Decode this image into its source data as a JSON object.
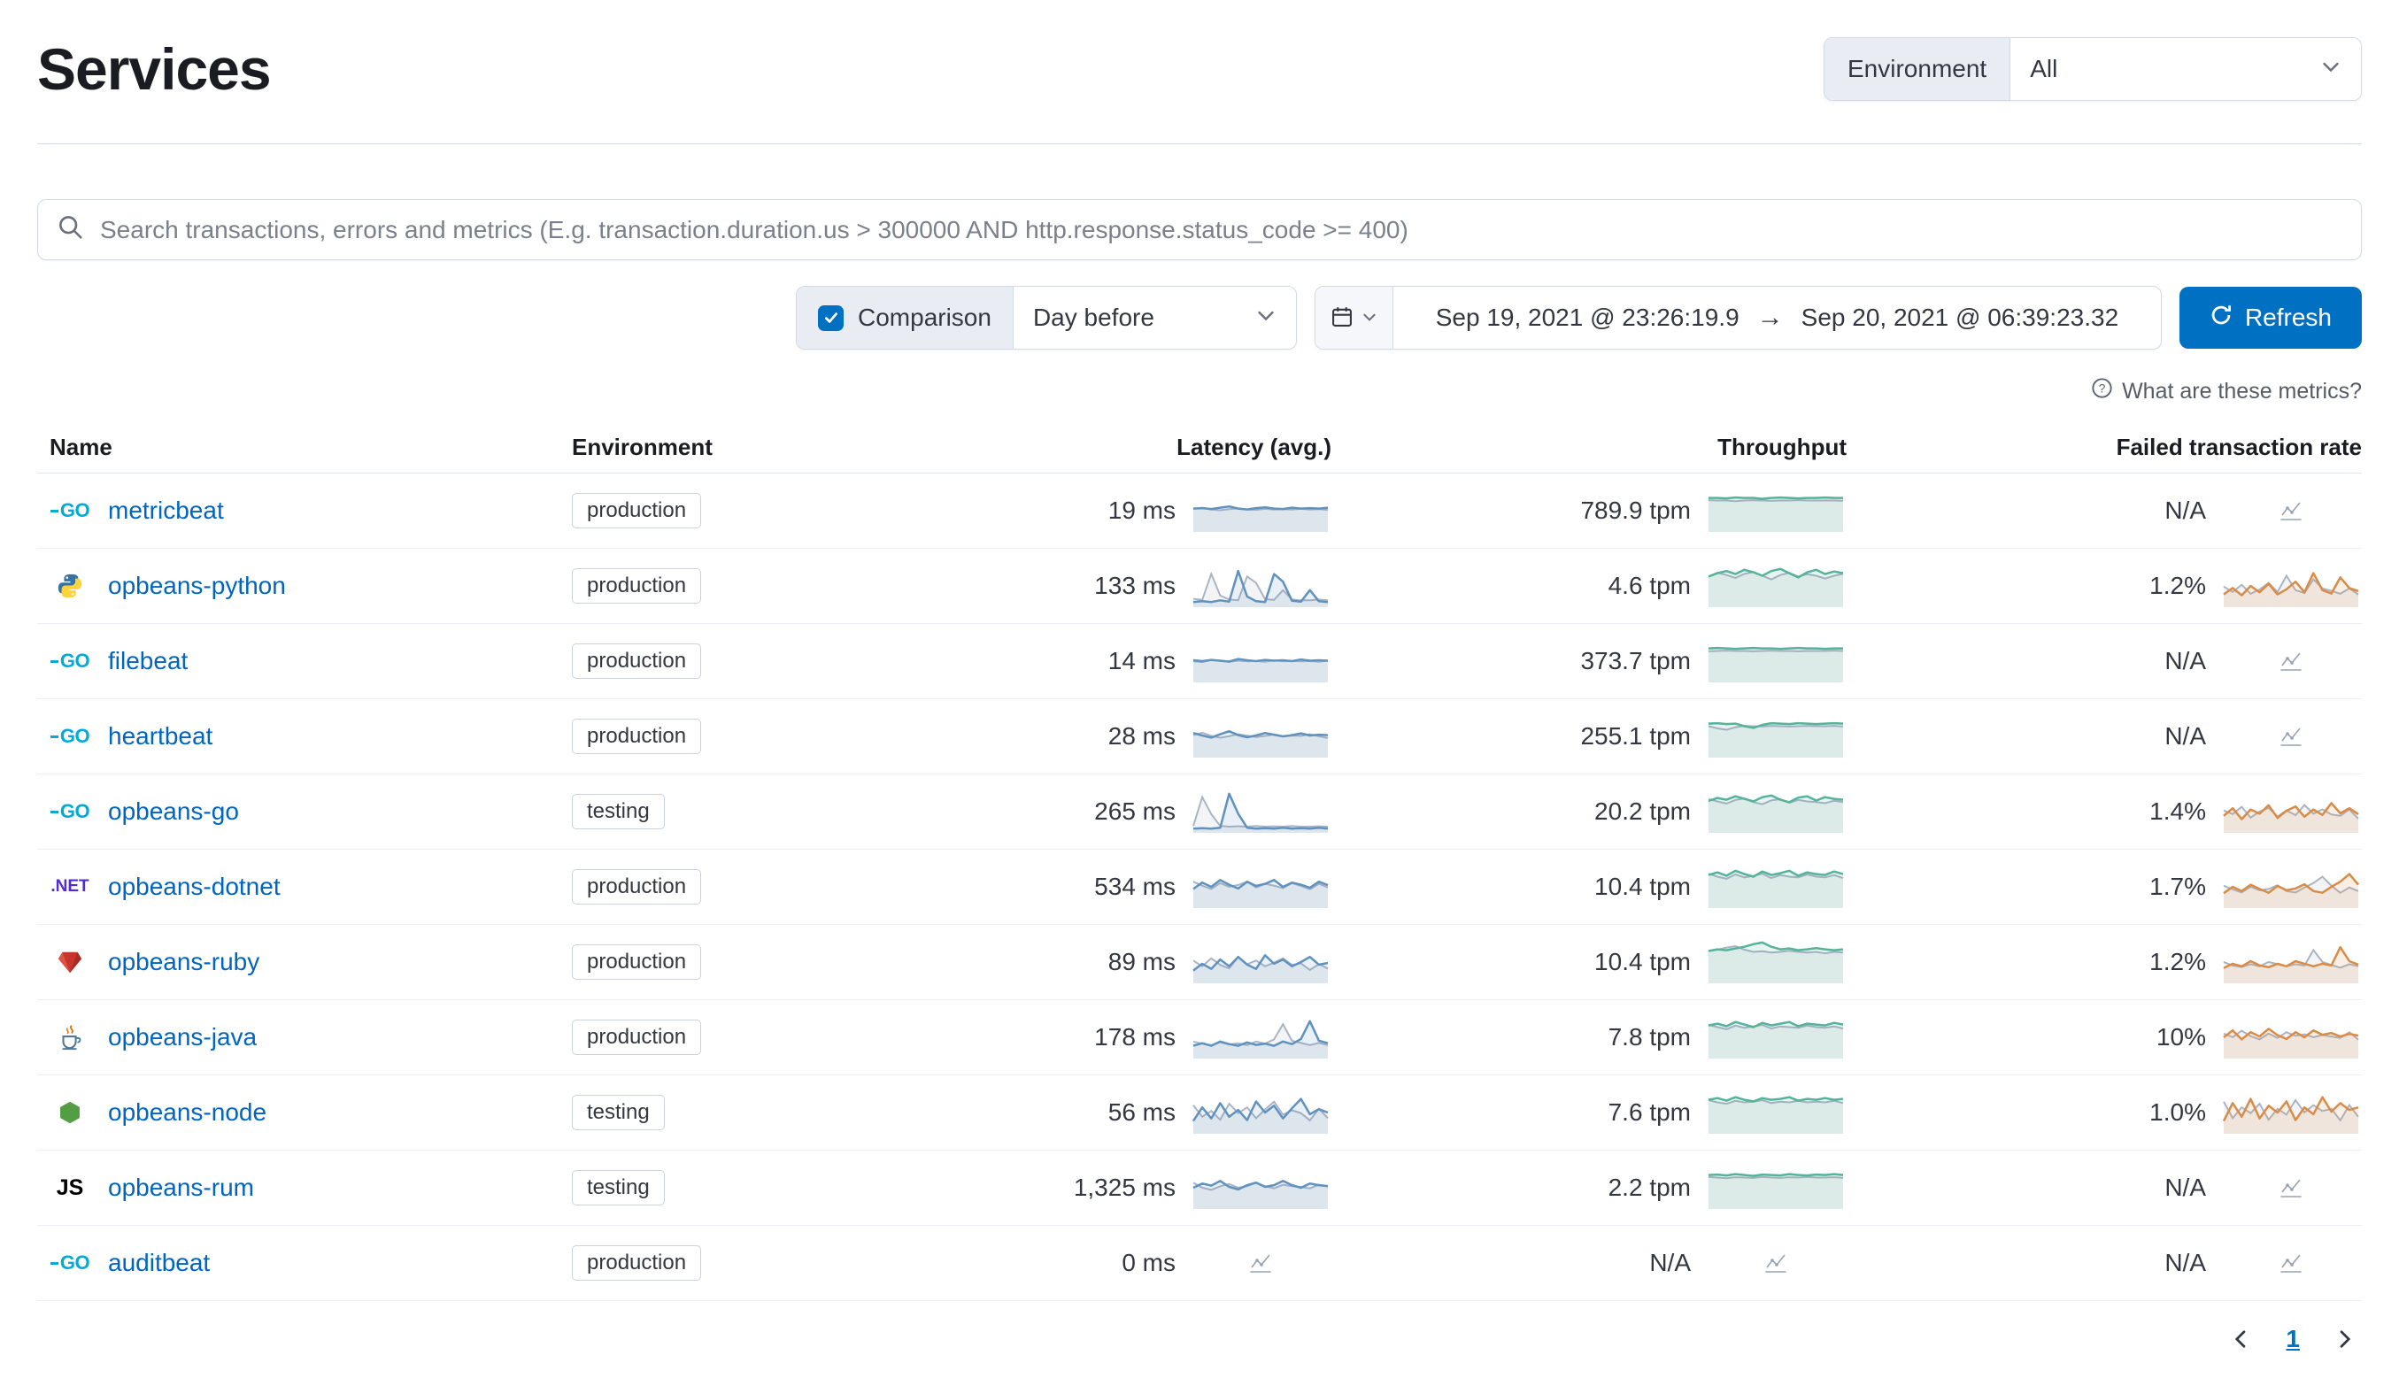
{
  "header": {
    "title": "Services",
    "environment_filter": {
      "label": "Environment",
      "value": "All"
    }
  },
  "search": {
    "placeholder": "Search transactions, errors and metrics (E.g. transaction.duration.us > 300000 AND http.response.status_code >= 400)"
  },
  "controls": {
    "comparison_label": "Comparison",
    "comparison_checked": true,
    "comparison_select": "Day before",
    "date_start": "Sep 19, 2021 @ 23:26:19.9",
    "date_end": "Sep 20, 2021 @ 06:39:23.32",
    "refresh_label": "Refresh"
  },
  "metrics_help": "What are these metrics?",
  "colors": {
    "latency": "#6092C0",
    "throughput": "#54B399",
    "failed": "#DA8B45",
    "comparison": "#ABB4C4"
  },
  "table": {
    "columns": [
      "Name",
      "Environment",
      "Latency (avg.)",
      "Throughput",
      "Failed transaction rate"
    ],
    "rows": [
      {
        "name": "metricbeat",
        "agent": "go",
        "environment": "production",
        "latency": "19 ms",
        "throughput": "789.9 tpm",
        "failed_rate": "N/A",
        "sparks": {
          "latency": [
            0.55,
            0.56,
            0.54,
            0.57,
            0.6,
            0.55,
            0.53,
            0.56,
            0.58,
            0.55,
            0.54,
            0.57,
            0.55,
            0.56,
            0.55,
            0.57
          ],
          "throughput": [
            0.8,
            0.8,
            0.79,
            0.81,
            0.8,
            0.8,
            0.78,
            0.8,
            0.81,
            0.8,
            0.79,
            0.8,
            0.8,
            0.81,
            0.8,
            0.8
          ],
          "failed": null
        }
      },
      {
        "name": "opbeans-python",
        "agent": "python",
        "environment": "production",
        "latency": "133 ms",
        "throughput": "4.6 tpm",
        "failed_rate": "1.2%",
        "sparks": {
          "latency": [
            0.12,
            0.14,
            0.12,
            0.16,
            0.13,
            0.85,
            0.25,
            0.14,
            0.12,
            0.78,
            0.6,
            0.15,
            0.13,
            0.4,
            0.14,
            0.12
          ],
          "throughput": [
            0.72,
            0.8,
            0.85,
            0.78,
            0.88,
            0.82,
            0.74,
            0.85,
            0.9,
            0.8,
            0.7,
            0.82,
            0.88,
            0.78,
            0.84,
            0.8
          ],
          "failed": [
            0.3,
            0.45,
            0.28,
            0.5,
            0.35,
            0.55,
            0.3,
            0.42,
            0.6,
            0.35,
            0.8,
            0.4,
            0.32,
            0.7,
            0.45,
            0.38
          ]
        }
      },
      {
        "name": "filebeat",
        "agent": "go",
        "environment": "production",
        "latency": "14 ms",
        "throughput": "373.7 tpm",
        "failed_rate": "N/A",
        "sparks": {
          "latency": [
            0.52,
            0.5,
            0.53,
            0.51,
            0.49,
            0.55,
            0.52,
            0.5,
            0.53,
            0.51,
            0.52,
            0.5,
            0.54,
            0.51,
            0.52,
            0.51
          ],
          "throughput": [
            0.8,
            0.81,
            0.8,
            0.79,
            0.8,
            0.81,
            0.8,
            0.8,
            0.79,
            0.8,
            0.81,
            0.8,
            0.8,
            0.79,
            0.8,
            0.8
          ],
          "failed": null
        }
      },
      {
        "name": "heartbeat",
        "agent": "go",
        "environment": "production",
        "latency": "28 ms",
        "throughput": "255.1 tpm",
        "failed_rate": "N/A",
        "sparks": {
          "latency": [
            0.58,
            0.52,
            0.47,
            0.55,
            0.62,
            0.53,
            0.48,
            0.52,
            0.58,
            0.54,
            0.5,
            0.53,
            0.57,
            0.52,
            0.54,
            0.53
          ],
          "throughput": [
            0.8,
            0.81,
            0.79,
            0.8,
            0.74,
            0.7,
            0.77,
            0.81,
            0.8,
            0.79,
            0.81,
            0.8,
            0.79,
            0.8,
            0.81,
            0.8
          ],
          "failed": null
        }
      },
      {
        "name": "opbeans-go",
        "agent": "go",
        "environment": "testing",
        "latency": "265 ms",
        "throughput": "20.2 tpm",
        "failed_rate": "1.4%",
        "sparks": {
          "latency": [
            0.1,
            0.11,
            0.1,
            0.12,
            0.92,
            0.45,
            0.12,
            0.1,
            0.11,
            0.1,
            0.12,
            0.1,
            0.11,
            0.1,
            0.12,
            0.1
          ],
          "throughput": [
            0.75,
            0.82,
            0.78,
            0.86,
            0.8,
            0.74,
            0.84,
            0.88,
            0.78,
            0.72,
            0.83,
            0.86,
            0.76,
            0.84,
            0.8,
            0.78
          ],
          "failed": [
            0.4,
            0.58,
            0.32,
            0.55,
            0.45,
            0.65,
            0.35,
            0.52,
            0.62,
            0.38,
            0.55,
            0.42,
            0.7,
            0.46,
            0.58,
            0.44
          ]
        }
      },
      {
        "name": "opbeans-dotnet",
        "agent": "dotnet",
        "environment": "production",
        "latency": "534 ms",
        "throughput": "10.4 tpm",
        "failed_rate": "1.7%",
        "sparks": {
          "latency": [
            0.45,
            0.6,
            0.5,
            0.66,
            0.55,
            0.46,
            0.62,
            0.52,
            0.57,
            0.66,
            0.5,
            0.6,
            0.55,
            0.48,
            0.62,
            0.54
          ],
          "throughput": [
            0.78,
            0.84,
            0.76,
            0.88,
            0.8,
            0.74,
            0.86,
            0.78,
            0.82,
            0.88,
            0.76,
            0.84,
            0.8,
            0.78,
            0.86,
            0.8
          ],
          "failed": [
            0.35,
            0.5,
            0.4,
            0.55,
            0.45,
            0.36,
            0.52,
            0.42,
            0.46,
            0.56,
            0.4,
            0.36,
            0.5,
            0.62,
            0.8,
            0.55
          ]
        }
      },
      {
        "name": "opbeans-ruby",
        "agent": "ruby",
        "environment": "production",
        "latency": "89 ms",
        "throughput": "10.4 tpm",
        "failed_rate": "1.2%",
        "sparks": {
          "latency": [
            0.3,
            0.46,
            0.34,
            0.56,
            0.4,
            0.62,
            0.44,
            0.34,
            0.66,
            0.46,
            0.56,
            0.4,
            0.5,
            0.62,
            0.44,
            0.48
          ],
          "throughput": [
            0.76,
            0.8,
            0.78,
            0.82,
            0.86,
            0.92,
            0.96,
            0.86,
            0.8,
            0.82,
            0.78,
            0.8,
            0.83,
            0.8,
            0.78,
            0.8
          ],
          "failed": [
            0.36,
            0.46,
            0.4,
            0.52,
            0.42,
            0.38,
            0.46,
            0.4,
            0.52,
            0.46,
            0.4,
            0.46,
            0.42,
            0.85,
            0.52,
            0.44
          ]
        }
      },
      {
        "name": "opbeans-java",
        "agent": "java",
        "environment": "production",
        "latency": "178 ms",
        "throughput": "7.8 tpm",
        "failed_rate": "10%",
        "sparks": {
          "latency": [
            0.3,
            0.36,
            0.3,
            0.4,
            0.34,
            0.3,
            0.38,
            0.32,
            0.35,
            0.3,
            0.4,
            0.34,
            0.46,
            0.88,
            0.42,
            0.36
          ],
          "throughput": [
            0.78,
            0.82,
            0.76,
            0.86,
            0.8,
            0.74,
            0.84,
            0.78,
            0.82,
            0.86,
            0.76,
            0.82,
            0.8,
            0.78,
            0.84,
            0.8
          ],
          "failed": [
            0.5,
            0.66,
            0.45,
            0.62,
            0.52,
            0.7,
            0.55,
            0.46,
            0.62,
            0.5,
            0.66,
            0.56,
            0.6,
            0.52,
            0.58,
            0.54
          ]
        }
      },
      {
        "name": "opbeans-node",
        "agent": "node",
        "environment": "testing",
        "latency": "56 ms",
        "throughput": "7.6 tpm",
        "failed_rate": "1.0%",
        "sparks": {
          "latency": [
            0.3,
            0.62,
            0.36,
            0.72,
            0.4,
            0.56,
            0.32,
            0.76,
            0.5,
            0.66,
            0.36,
            0.6,
            0.82,
            0.46,
            0.58,
            0.5
          ],
          "throughput": [
            0.8,
            0.84,
            0.78,
            0.86,
            0.8,
            0.76,
            0.84,
            0.8,
            0.82,
            0.86,
            0.78,
            0.82,
            0.8,
            0.84,
            0.8,
            0.82
          ],
          "failed": [
            0.3,
            0.72,
            0.4,
            0.82,
            0.36,
            0.66,
            0.5,
            0.76,
            0.32,
            0.62,
            0.46,
            0.86,
            0.52,
            0.72,
            0.56,
            0.62
          ]
        }
      },
      {
        "name": "opbeans-rum",
        "agent": "js",
        "environment": "testing",
        "latency": "1,325 ms",
        "throughput": "2.2 tpm",
        "failed_rate": "N/A",
        "sparks": {
          "latency": [
            0.5,
            0.6,
            0.55,
            0.66,
            0.52,
            0.46,
            0.56,
            0.62,
            0.52,
            0.56,
            0.66,
            0.56,
            0.5,
            0.6,
            0.56,
            0.54
          ],
          "throughput": [
            0.8,
            0.81,
            0.79,
            0.82,
            0.8,
            0.78,
            0.81,
            0.8,
            0.79,
            0.82,
            0.8,
            0.79,
            0.81,
            0.8,
            0.82,
            0.8
          ],
          "failed": null
        }
      },
      {
        "name": "auditbeat",
        "agent": "go",
        "environment": "production",
        "latency": "0 ms",
        "throughput": "N/A",
        "failed_rate": "N/A",
        "sparks": {
          "latency": null,
          "throughput": null,
          "failed": null
        }
      }
    ]
  },
  "pagination": {
    "page": "1"
  }
}
